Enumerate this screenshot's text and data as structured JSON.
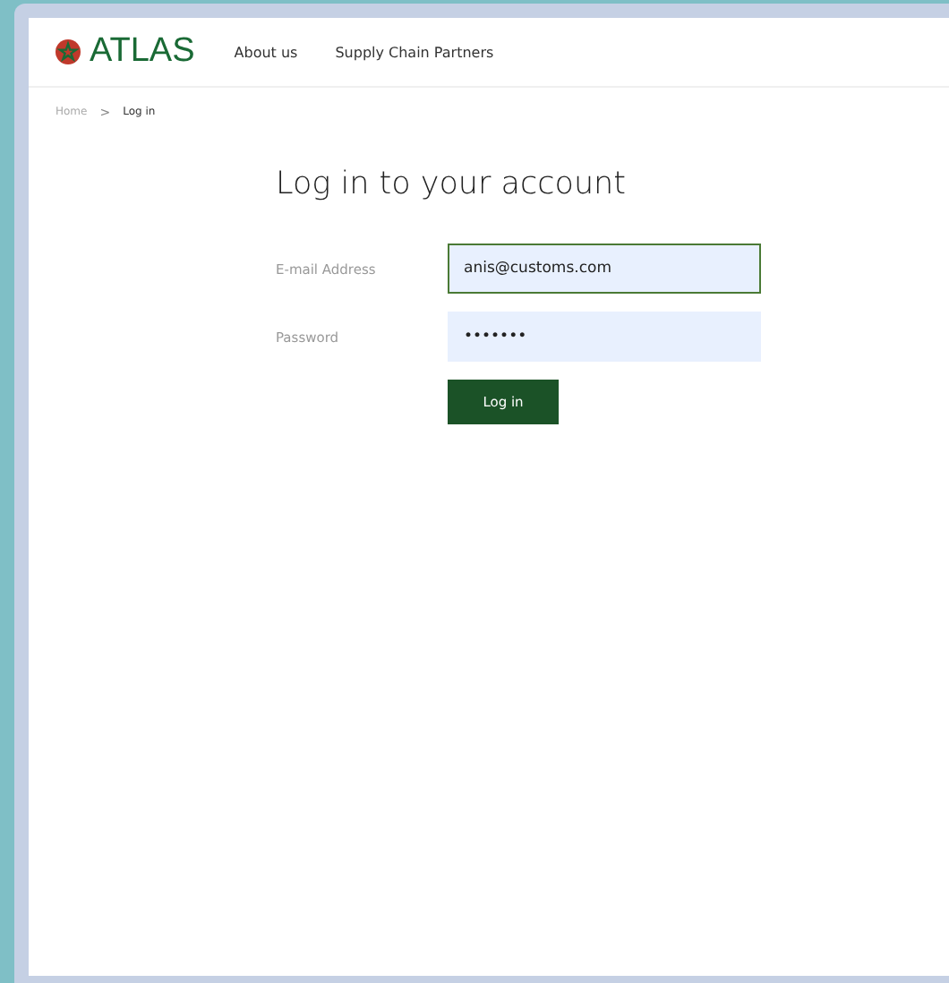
{
  "header": {
    "logo": "ATLAS",
    "nav": [
      {
        "label": "About us"
      },
      {
        "label": "Supply Chain Partners"
      }
    ]
  },
  "breadcrumb": [
    {
      "label": "Home",
      "current": false
    },
    {
      "label": ">",
      "kind": "separator"
    },
    {
      "label": "Log in",
      "current": true
    }
  ],
  "title": "Log in to your account",
  "fields": [
    {
      "label": "E-mail Address",
      "value": "anis@customs.com",
      "focused": true
    },
    {
      "label": "Password",
      "value": "•••••••",
      "focused": false
    }
  ],
  "submit": "Log in"
}
